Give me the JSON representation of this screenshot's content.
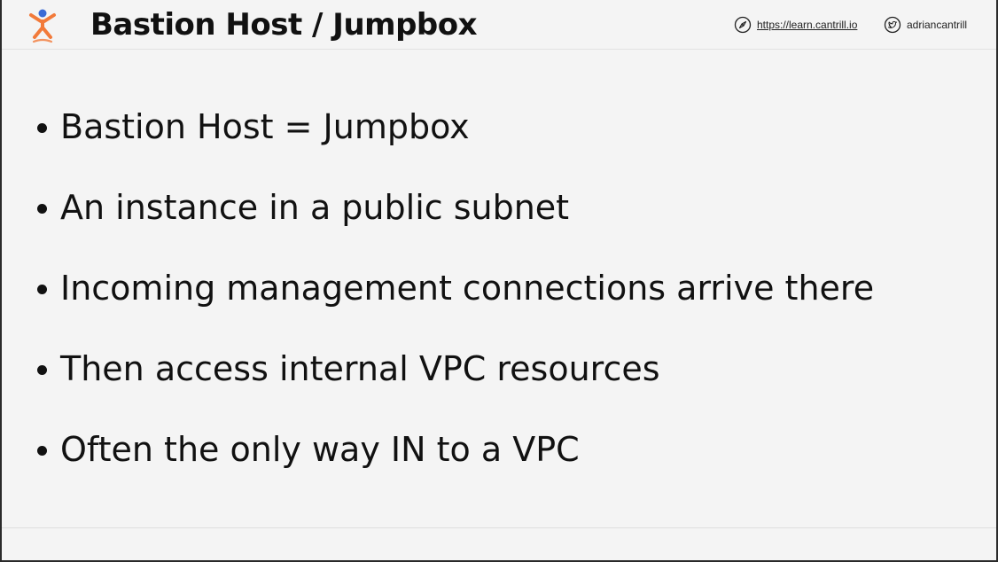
{
  "header": {
    "title": "Bastion Host / Jumpbox",
    "website": "https://learn.cantrill.io",
    "twitter": "adriancantrill"
  },
  "bullets": [
    "Bastion Host = Jumpbox",
    "An instance in a public subnet",
    "Incoming management connections arrive there",
    "Then access internal VPC resources",
    "Often the only way IN to a VPC"
  ],
  "colors": {
    "background": "#f4f4f4",
    "text": "#111111",
    "logo_orange": "#f27a3a",
    "logo_blue": "#3a6bd6"
  },
  "icons": {
    "logo": "stick-figure-logo",
    "website": "compass-icon",
    "twitter": "twitter-bird-icon"
  }
}
